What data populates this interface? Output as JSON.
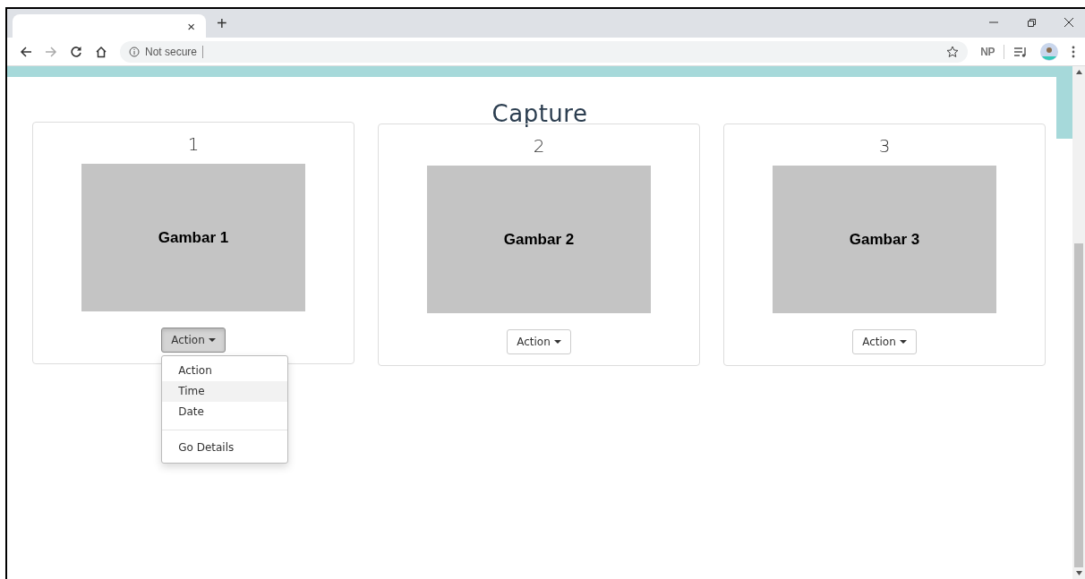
{
  "browser": {
    "tab_close": "×",
    "new_tab": "+",
    "address": {
      "security": "Not secure"
    },
    "profile_label": "NP"
  },
  "page": {
    "title": "Capture",
    "cards": [
      {
        "number": "1",
        "image_label": "Gambar 1",
        "button": "Action",
        "open": true
      },
      {
        "number": "2",
        "image_label": "Gambar 2",
        "button": "Action",
        "open": false
      },
      {
        "number": "3",
        "image_label": "Gambar 3",
        "button": "Action",
        "open": false
      }
    ],
    "dropdown": {
      "items": [
        {
          "label": "Action",
          "selected": false,
          "kind": "item"
        },
        {
          "label": "Time",
          "selected": true,
          "kind": "item"
        },
        {
          "label": "Date",
          "selected": false,
          "kind": "item"
        },
        {
          "kind": "divider"
        },
        {
          "label": "Go Details",
          "selected": false,
          "kind": "item"
        }
      ]
    }
  }
}
